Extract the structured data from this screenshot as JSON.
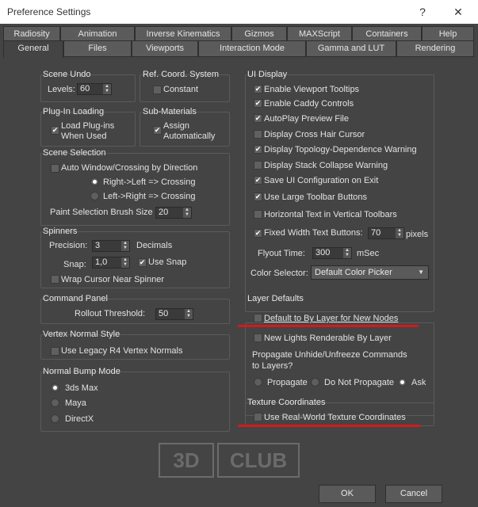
{
  "window": {
    "title": "Preference Settings",
    "help_glyph": "?",
    "close_glyph": "✕"
  },
  "tabs_row1": [
    "Radiosity",
    "Animation",
    "Inverse Kinematics",
    "Gizmos",
    "MAXScript",
    "Containers",
    "Help"
  ],
  "tabs_row2": [
    "General",
    "Files",
    "Viewports",
    "Interaction Mode",
    "Gamma and LUT",
    "Rendering"
  ],
  "active_tab": "General",
  "scene_undo": {
    "title": "Scene Undo",
    "levels_label": "Levels:",
    "levels_value": "60"
  },
  "ref_coord": {
    "title": "Ref. Coord. System",
    "constant_label": "Constant",
    "constant_checked": false
  },
  "plugin_loading": {
    "title": "Plug-In Loading",
    "label_line1": "Load Plug-ins",
    "label_line2": "When Used",
    "checked": true
  },
  "sub_materials": {
    "title": "Sub-Materials",
    "label_line1": "Assign",
    "label_line2": "Automatically",
    "checked": true
  },
  "scene_selection": {
    "title": "Scene Selection",
    "auto_window_label": "Auto Window/Crossing by Direction",
    "auto_window_checked": false,
    "right_left_label": "Right->Left => Crossing",
    "left_right_label": "Left->Right => Crossing",
    "selected": "right_left",
    "brush_size_label": "Paint Selection Brush Size",
    "brush_size_value": "20"
  },
  "spinners": {
    "title": "Spinners",
    "precision_label": "Precision:",
    "precision_value": "3",
    "decimals_label": "Decimals",
    "snap_label": "Snap:",
    "snap_value": "1,0",
    "use_snap_label": "Use Snap",
    "use_snap_checked": true,
    "wrap_cursor_label": "Wrap Cursor Near Spinner",
    "wrap_cursor_checked": false
  },
  "command_panel": {
    "title": "Command Panel",
    "rollout_label": "Rollout Threshold:",
    "rollout_value": "50"
  },
  "vertex_normal": {
    "title": "Vertex Normal Style",
    "legacy_label": "Use Legacy R4 Vertex Normals",
    "legacy_checked": false
  },
  "normal_bump": {
    "title": "Normal Bump Mode",
    "options": [
      "3ds Max",
      "Maya",
      "DirectX"
    ],
    "selected_index": 0
  },
  "ui_display": {
    "title": "UI Display",
    "items": [
      {
        "label": "Enable Viewport Tooltips",
        "checked": true
      },
      {
        "label": "Enable Caddy Controls",
        "checked": true
      },
      {
        "label": "AutoPlay Preview File",
        "checked": true
      },
      {
        "label": "Display Cross Hair Cursor",
        "checked": false
      },
      {
        "label": "Display Topology-Dependence Warning",
        "checked": true
      },
      {
        "label": "Display Stack Collapse Warning",
        "checked": false
      },
      {
        "label": "Save UI Configuration on Exit",
        "checked": true
      },
      {
        "label": "Use Large Toolbar Buttons",
        "checked": true
      },
      {
        "label": "Horizontal Text in Vertical Toolbars",
        "checked": false
      }
    ],
    "fixed_width_label": "Fixed Width Text Buttons:",
    "fixed_width_checked": true,
    "fixed_width_value": "70",
    "pixels_label": "pixels",
    "flyout_label": "Flyout Time:",
    "flyout_value": "300",
    "msec_label": "mSec",
    "color_selector_label": "Color Selector:",
    "color_selector_value": "Default Color Picker"
  },
  "layer_defaults": {
    "title": "Layer Defaults",
    "by_layer_label": "Default to By Layer for New Nodes",
    "by_layer_checked": false,
    "new_lights_label": "New Lights Renderable By Layer",
    "new_lights_checked": false,
    "propagate_line1": "Propagate Unhide/Unfreeze Commands",
    "propagate_line2": "to Layers?",
    "propagate_options": [
      "Propagate",
      "Do Not Propagate",
      "Ask"
    ],
    "propagate_selected_index": 2
  },
  "texture_coords": {
    "title": "Texture Coordinates",
    "real_world_label": "Use Real-World Texture Coordinates",
    "real_world_checked": false
  },
  "watermark": {
    "left": "3D",
    "right": "CLUB"
  },
  "buttons": {
    "ok": "OK",
    "cancel": "Cancel"
  },
  "colors": {
    "highlight": "#d41a1a",
    "background": "#444444"
  }
}
